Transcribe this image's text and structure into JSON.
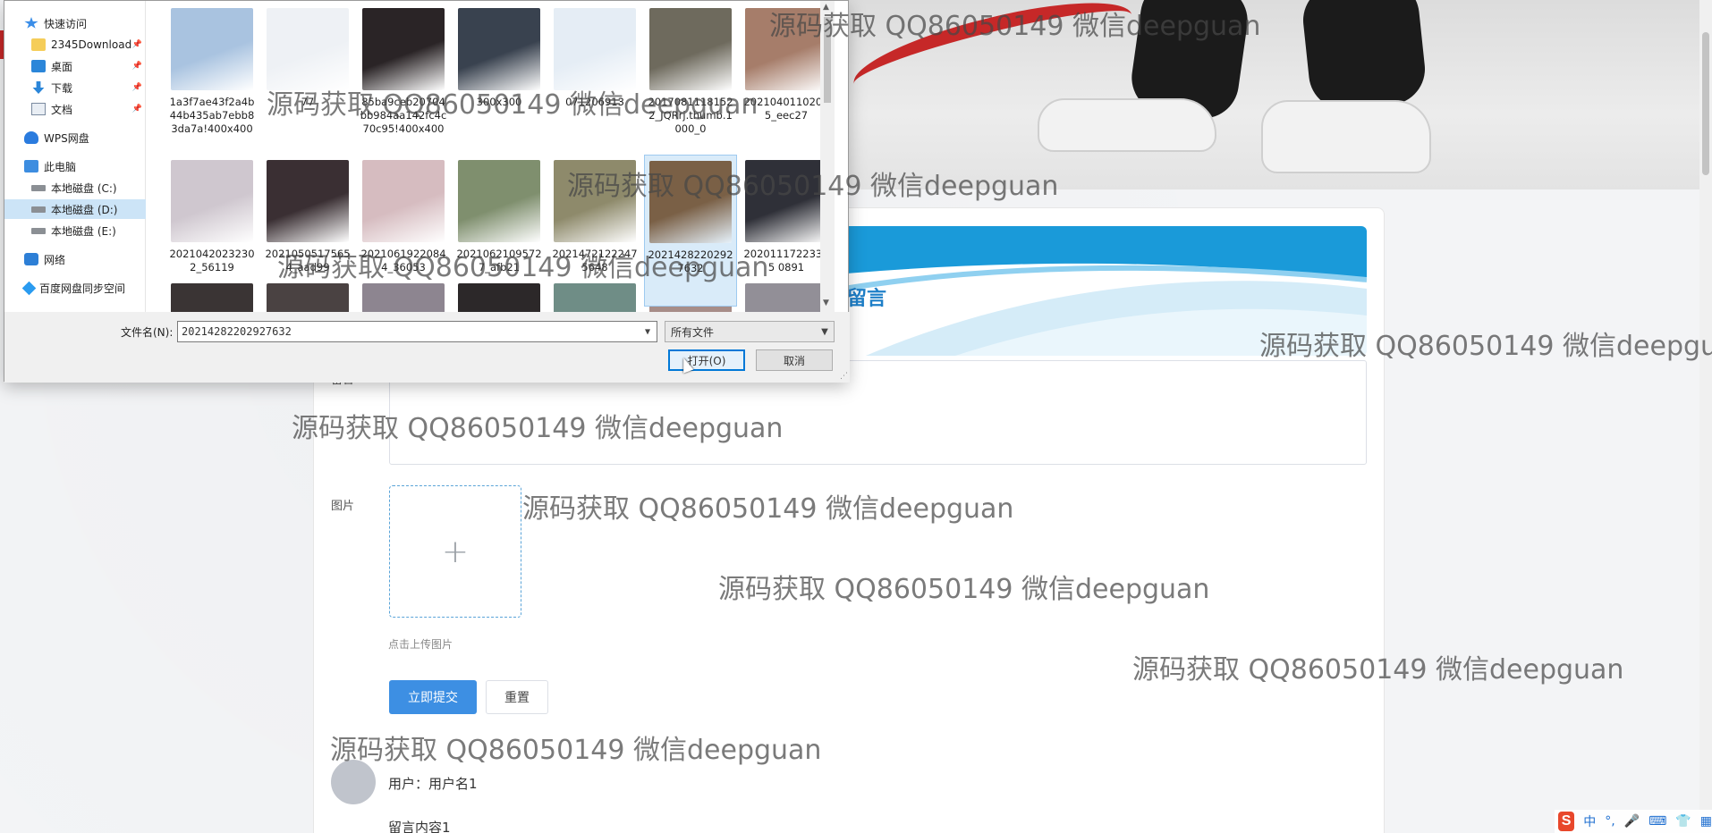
{
  "dialog": {
    "nav": [
      {
        "label": "快速访问",
        "icon": "star-icon",
        "pinned": false,
        "selected": false
      },
      {
        "label": "2345Download",
        "icon": "folder-icon",
        "pinned": true,
        "selected": false
      },
      {
        "label": "桌面",
        "icon": "desktop-icon",
        "pinned": true,
        "selected": false
      },
      {
        "label": "下载",
        "icon": "download-icon",
        "pinned": true,
        "selected": false
      },
      {
        "label": "文档",
        "icon": "document-icon",
        "pinned": true,
        "selected": false
      },
      {
        "label": "WPS网盘",
        "icon": "cloud-icon",
        "pinned": false,
        "selected": false
      },
      {
        "label": "此电脑",
        "icon": "computer-icon",
        "pinned": false,
        "selected": false
      },
      {
        "label": "本地磁盘 (C:)",
        "icon": "drive-icon",
        "pinned": false,
        "selected": false
      },
      {
        "label": "本地磁盘 (D:)",
        "icon": "drive-icon",
        "pinned": false,
        "selected": true
      },
      {
        "label": "本地磁盘 (E:)",
        "icon": "drive-icon",
        "pinned": false,
        "selected": false
      },
      {
        "label": "网络",
        "icon": "network-icon",
        "pinned": false,
        "selected": false
      },
      {
        "label": "百度网盘同步空间",
        "icon": "baidu-cloud-icon",
        "pinned": false,
        "selected": false
      }
    ],
    "files": [
      {
        "name": "1a3f7ae43f2a4b44b435ab7ebb83da7a!400x400",
        "color": "#a9c3e0",
        "selected": false
      },
      {
        "name": "77",
        "color": "#eef1f5",
        "selected": false
      },
      {
        "name": "85ba9ceb20704bb984aa142fc4c70c95!400x400",
        "color": "#2a2426",
        "selected": false
      },
      {
        "name": "300x300",
        "color": "#39424f",
        "selected": false
      },
      {
        "name": "071206913",
        "color": "#e5edf5",
        "selected": false
      },
      {
        "name": "20170811181522_JQRrj.thumb.1000_0",
        "color": "#6e6a5d",
        "selected": false
      },
      {
        "name": "20210401102025_eec27",
        "color": "#a67d6a",
        "selected": false
      },
      {
        "name": "20210420232302_56119",
        "color": "#cfc7cf",
        "selected": false
      },
      {
        "name": "20210505175654_aad99",
        "color": "#3a2f33",
        "selected": false
      },
      {
        "name": "20210619220844_36053",
        "color": "#d6bcc0",
        "selected": false
      },
      {
        "name": "20210621095727_afb21",
        "color": "#7f8f6e",
        "selected": false
      },
      {
        "name": "20214721222475648",
        "color": "#8e8a6b",
        "selected": false
      },
      {
        "name": "20214282202927632",
        "color": "#7a6046",
        "selected": true
      },
      {
        "name": "20201117223305 0891",
        "color": "#2f3038",
        "selected": false
      },
      {
        "name": "",
        "color": "#3a3434",
        "selected": false
      },
      {
        "name": "",
        "color": "#4a4242",
        "selected": false
      },
      {
        "name": "",
        "color": "#8d8590",
        "selected": false
      },
      {
        "name": "",
        "color": "#2c2829",
        "selected": false
      },
      {
        "name": "",
        "color": "#6f8d86",
        "selected": false
      },
      {
        "name": "",
        "color": "#a78d88",
        "selected": false
      },
      {
        "name": "",
        "color": "#928f97",
        "selected": false
      }
    ],
    "filename_label": "文件名(N):",
    "filename_value": "20214282202927632",
    "filetype_value": "所有文件",
    "open_label": "打开(O)",
    "cancel_label": "取消"
  },
  "page": {
    "banner_title": "留言",
    "message_label": "留言",
    "image_label": "图片",
    "upload_plus": "+",
    "upload_hint": "点击上传图片",
    "submit_label": "立即提交",
    "reset_label": "重置",
    "comment_user": "用户：用户名1",
    "comment_text": "留言内容1"
  },
  "watermark": "源码获取 QQ86050149 微信deepguan",
  "tray": {
    "logo": "S",
    "ime_mode": "中",
    "punct": "°,",
    "icons": [
      "microphone-icon",
      "keyboard-icon",
      "shirt-icon",
      "grid-icon"
    ]
  },
  "colors": {
    "accent": "#3d8fe3",
    "banner_blue": "#1e9ad8",
    "selection": "#cce4f7"
  }
}
